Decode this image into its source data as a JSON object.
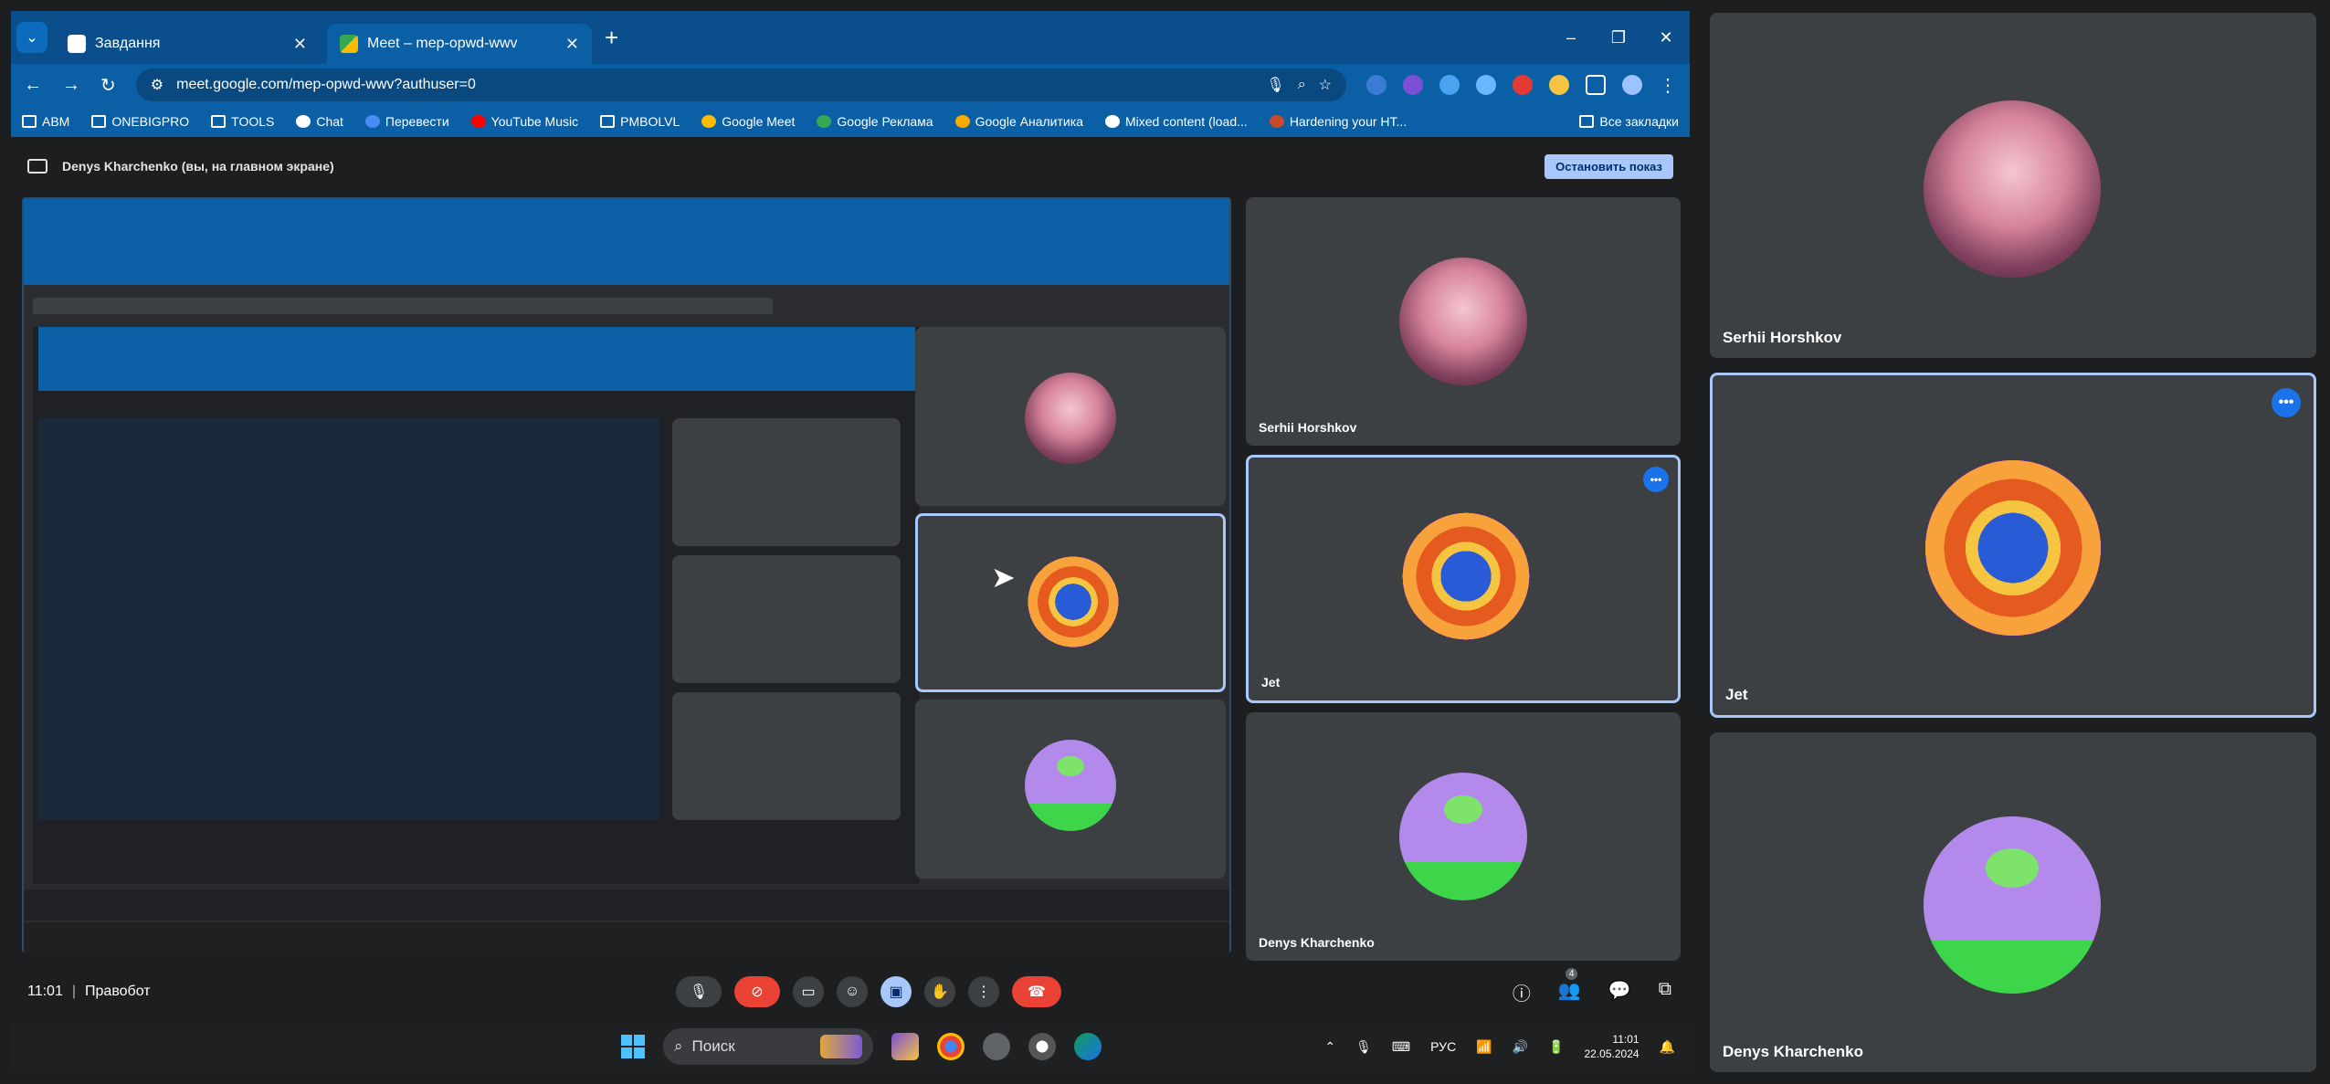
{
  "browser": {
    "tabs": [
      {
        "title": "Завдання",
        "active": false
      },
      {
        "title": "Meet – mep-opwd-wwv",
        "active": true
      }
    ],
    "new_tab": "+",
    "window_controls": [
      "–",
      "❐",
      "✕"
    ],
    "url": "meet.google.com/mep-opwd-wwv?authuser=0",
    "bookmarks": [
      "ABM",
      "ONEBIGPRO",
      "TOOLS",
      "Chat",
      "Перевести",
      "YouTube Music",
      "PMBOLVL",
      "Google Meet",
      "Google Реклама",
      "Google Аналитика",
      "Mixed content (load...",
      "Hardening your HT..."
    ],
    "all_bookmarks": "Все закладки"
  },
  "share": {
    "label": "Denys Kharchenko (вы, на главном экране)",
    "stop": "Остановить показ"
  },
  "participants": [
    {
      "name": "Serhii Horshkov"
    },
    {
      "name": "Jet",
      "more": "•••"
    },
    {
      "name": "Denys Kharchenko"
    }
  ],
  "controls": {
    "time": "11:01",
    "separator": "|",
    "meeting": "Правобот",
    "people_count": "4"
  },
  "taskbar": {
    "search": "Поиск",
    "lang": "РУС",
    "clock_time": "11:01",
    "clock_date": "22.05.2024"
  },
  "colors": {
    "browser": "#0b5fa5",
    "accent": "#a8c7fa",
    "hangup": "#ea4335",
    "bg": "#1d1e20"
  }
}
